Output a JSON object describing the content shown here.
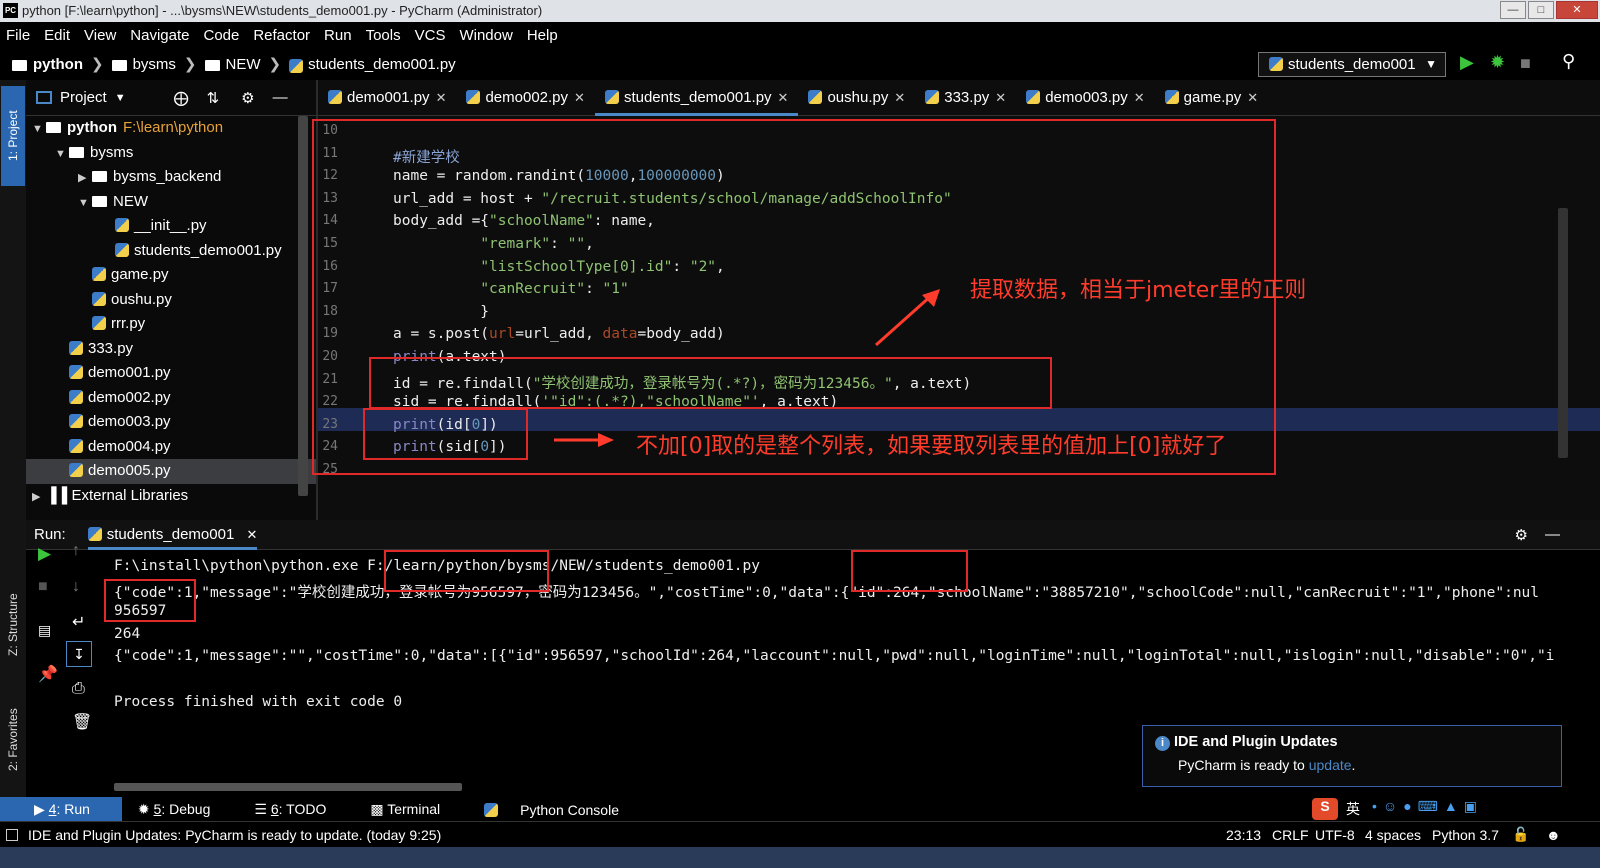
{
  "window": {
    "title": "python [F:\\learn\\python] - ...\\bysms\\NEW\\students_demo001.py - PyCharm (Administrator)",
    "app_icon": "PC"
  },
  "menu": [
    "File",
    "Edit",
    "View",
    "Navigate",
    "Code",
    "Refactor",
    "Run",
    "Tools",
    "VCS",
    "Window",
    "Help"
  ],
  "breadcrumb": [
    "python",
    "bysms",
    "NEW",
    "students_demo001.py"
  ],
  "run_config": "students_demo001",
  "project_panel": {
    "title": "Project",
    "tree": [
      {
        "label": "python",
        "path": "F:\\learn\\python",
        "indent": 0,
        "type": "folder",
        "open": true
      },
      {
        "label": "bysms",
        "indent": 1,
        "type": "folder",
        "open": true
      },
      {
        "label": "bysms_backend",
        "indent": 2,
        "type": "folder",
        "open": false
      },
      {
        "label": "NEW",
        "indent": 2,
        "type": "folder",
        "open": true
      },
      {
        "label": "__init__.py",
        "indent": 3,
        "type": "py"
      },
      {
        "label": "students_demo001.py",
        "indent": 3,
        "type": "py"
      },
      {
        "label": "game.py",
        "indent": 2,
        "type": "py"
      },
      {
        "label": "oushu.py",
        "indent": 2,
        "type": "py"
      },
      {
        "label": "rrr.py",
        "indent": 2,
        "type": "py"
      },
      {
        "label": "333.py",
        "indent": 1,
        "type": "py"
      },
      {
        "label": "demo001.py",
        "indent": 1,
        "type": "py"
      },
      {
        "label": "demo002.py",
        "indent": 1,
        "type": "py"
      },
      {
        "label": "demo003.py",
        "indent": 1,
        "type": "py"
      },
      {
        "label": "demo004.py",
        "indent": 1,
        "type": "py"
      },
      {
        "label": "demo005.py",
        "indent": 1,
        "type": "py",
        "selected": true
      },
      {
        "label": "External Libraries",
        "indent": 0,
        "type": "lib"
      }
    ]
  },
  "editor_tabs": [
    {
      "label": "demo001.py"
    },
    {
      "label": "demo002.py"
    },
    {
      "label": "students_demo001.py",
      "active": true
    },
    {
      "label": "oushu.py"
    },
    {
      "label": "333.py"
    },
    {
      "label": "demo003.py"
    },
    {
      "label": "game.py"
    }
  ],
  "code_lines": [
    {
      "n": "10",
      "html": ""
    },
    {
      "n": "11",
      "html": "<span class=\"cm\">#新建学校</span>"
    },
    {
      "n": "12",
      "html": "name = random.randint(<span class=\"num\">10000</span>,<span class=\"num\">100000000</span>)"
    },
    {
      "n": "13",
      "html": "url_add = host + <span class=\"str\">\"/recruit.students/school/manage/addSchoolInfo\"</span>"
    },
    {
      "n": "14",
      "html": "body_add ={<span class=\"str\">\"schoolName\"</span>: name,"
    },
    {
      "n": "15",
      "html": "          <span class=\"str\">\"remark\"</span>: <span class=\"str\">\"\"</span>,"
    },
    {
      "n": "16",
      "html": "          <span class=\"str\">\"listSchoolType[0].id\"</span>: <span class=\"str\">\"2\"</span>,"
    },
    {
      "n": "17",
      "html": "          <span class=\"str\">\"canRecruit\"</span>: <span class=\"str\">\"1\"</span>"
    },
    {
      "n": "18",
      "html": "          }"
    },
    {
      "n": "19",
      "html": "a = s.post(<span class=\"param\">url</span>=url_add, <span class=\"param\">data</span>=body_add)"
    },
    {
      "n": "20",
      "html": "<span class=\"fn\">print</span>(a.text)"
    },
    {
      "n": "21",
      "html": "id = re.findall(<span class=\"str\">\"学校创建成功，登录帐号为(.*?)，密码为123456。\"</span>, a.text)"
    },
    {
      "n": "22",
      "html": "sid = re.findall(<span class=\"str\">'\"id\":(.*?),\"schoolName\"'</span>, a.text)"
    },
    {
      "n": "23",
      "html": "<span class=\"fn\">print</span>(id[<span class=\"num\">0</span>])"
    },
    {
      "n": "24",
      "html": "<span class=\"fn\">print</span>(sid[<span class=\"num\">0</span>])"
    },
    {
      "n": "25",
      "html": ""
    }
  ],
  "annotations": {
    "top": "提取数据，相当于jmeter里的正则",
    "bottom": "不加[0]取的是整个列表，如果要取列表里的值加上[0]就好了"
  },
  "run_panel": {
    "label": "Run:",
    "tab": "students_demo001",
    "output": [
      "F:\\install\\python\\python.exe F:/learn/python/bysms/NEW/students_demo001.py",
      "{\"code\":1,\"message\":\"学校创建成功，登录帐号为956597，密码为123456。\",\"costTime\":0,\"data\":{\"id\":264,\"schoolName\":\"38857210\",\"schoolCode\":null,\"canRecruit\":\"1\",\"phone\":nul",
      "956597",
      "264",
      "{\"code\":1,\"message\":\"\",\"costTime\":0,\"data\":[{\"id\":956597,\"schoolId\":264,\"laccount\":null,\"pwd\":null,\"loginTime\":null,\"loginTotal\":null,\"islogin\":null,\"disable\":\"0\",\"i",
      "",
      "Process finished with exit code 0"
    ]
  },
  "notification": {
    "title": "IDE and Plugin Updates",
    "text": "PyCharm is ready to ",
    "link": "update",
    "tail": "."
  },
  "bottom_tabs": [
    {
      "num": "4",
      "label": ": Run"
    },
    {
      "num": "5",
      "label": ": Debug"
    },
    {
      "num": "6",
      "label": ": TODO"
    },
    {
      "num": "",
      "label": "Terminal"
    },
    {
      "num": "",
      "label": "Python Console"
    }
  ],
  "status": {
    "message": "IDE and Plugin Updates: PyCharm is ready to update. (today 9:25)",
    "position": "23:13",
    "line_sep": "CRLF",
    "encoding": "UTF-8",
    "indent": "4 spaces",
    "interpreter": "Python 3.7"
  },
  "side_labels": {
    "project": "1: Project",
    "structure": "Z: Structure",
    "favorites": "2: Favorites"
  },
  "ime": "英",
  "colors": {
    "annotation": "#ff3c2c",
    "highlight_line": "#1e2b55",
    "accent": "#4a88c7",
    "run_green": "#3cc43c"
  }
}
